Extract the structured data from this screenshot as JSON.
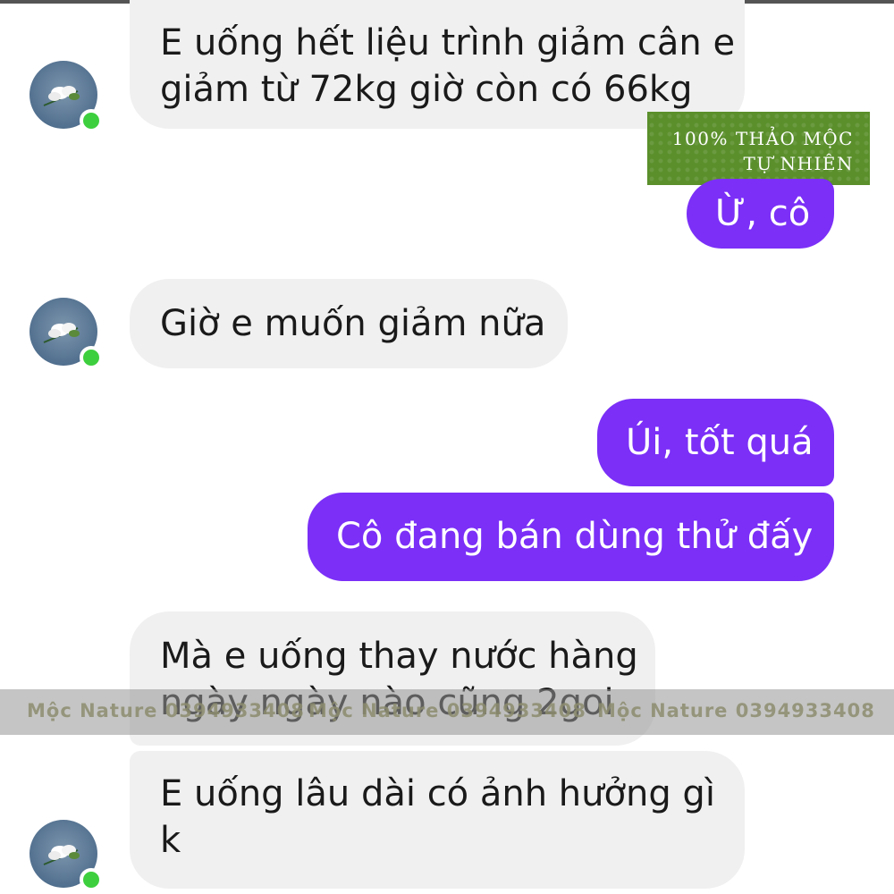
{
  "brand": {
    "badge_line1": "100% THẢO MỘC",
    "badge_line2": "TỰ NHIÊN",
    "watermark_left": "Mộc Nature 0394933408",
    "watermark_mid": "Mộc Nature 0394933408",
    "watermark_right": "Mộc Nature 0394933408"
  },
  "colors": {
    "outgoing_bubble": "#7b2ff7",
    "incoming_bubble": "#f0f0f0",
    "online_dot": "#3ecf3e",
    "badge": "#5a8f2b"
  },
  "messages": [
    {
      "from": "contact",
      "lines": [
        "E uống hết liệu trình giảm cân e",
        "giảm từ 72kg giờ còn có 66kg"
      ]
    },
    {
      "from": "me",
      "lines": [
        "Ừ, cô"
      ]
    },
    {
      "from": "contact",
      "lines": [
        "Giờ e muốn giảm nữa"
      ]
    },
    {
      "from": "me",
      "lines": [
        "Úi, tốt quá"
      ]
    },
    {
      "from": "me",
      "lines": [
        "Cô đang bán dùng thử đấy"
      ]
    },
    {
      "from": "contact",
      "lines": [
        "Mà e uống thay nước hàng",
        "ngày ngày nào cũng 2goi"
      ]
    },
    {
      "from": "contact",
      "lines": [
        "E uống lâu dài có ảnh hưởng gì",
        "k"
      ]
    }
  ],
  "avatar_icon": "flower-avatar-icon",
  "online_icon": "online-status-dot"
}
